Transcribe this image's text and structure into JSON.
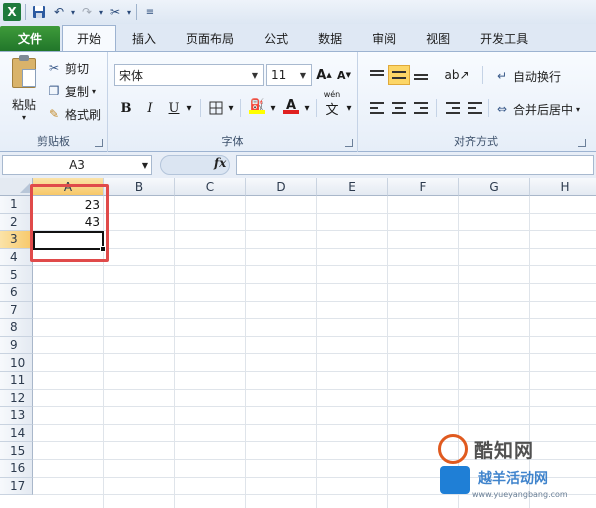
{
  "qat": {
    "icons": [
      "excel-logo",
      "save-icon",
      "undo-icon",
      "redo-icon",
      "format-painter-icon",
      "customize-icon"
    ],
    "excel_logo_text": "X"
  },
  "tabs": [
    {
      "label": "文件"
    },
    {
      "label": "开始"
    },
    {
      "label": "插入"
    },
    {
      "label": "页面布局"
    },
    {
      "label": "公式"
    },
    {
      "label": "数据"
    },
    {
      "label": "审阅"
    },
    {
      "label": "视图"
    },
    {
      "label": "开发工具"
    }
  ],
  "ribbon": {
    "clipboard": {
      "paste": "粘贴",
      "cut": "剪切",
      "copy": "复制",
      "painter": "格式刷",
      "group": "剪贴板"
    },
    "font": {
      "name": "宋体",
      "size": "11",
      "bold": "B",
      "italic": "I",
      "underline": "U",
      "grow": "A",
      "shrink": "A",
      "fontcolor": "A",
      "wen": "wén",
      "group": "字体"
    },
    "align": {
      "wrap": "自动换行",
      "merge": "合并后居中",
      "group": "对齐方式"
    }
  },
  "formula_bar": {
    "name_box": "A3",
    "fx": "fx",
    "value": ""
  },
  "sheet": {
    "columns": [
      "A",
      "B",
      "C",
      "D",
      "E",
      "F",
      "G",
      "H"
    ],
    "rows": [
      "1",
      "2",
      "3",
      "4",
      "5",
      "6",
      "7",
      "8",
      "9",
      "10",
      "11",
      "12",
      "13",
      "14",
      "15",
      "16",
      "17"
    ],
    "cells": {
      "A1": "23",
      "A2": "43"
    },
    "active": "A3"
  },
  "watermark": {
    "line1": "酷知网",
    "line2": "越羊活动网",
    "url": "www.yueyangbang.com"
  }
}
